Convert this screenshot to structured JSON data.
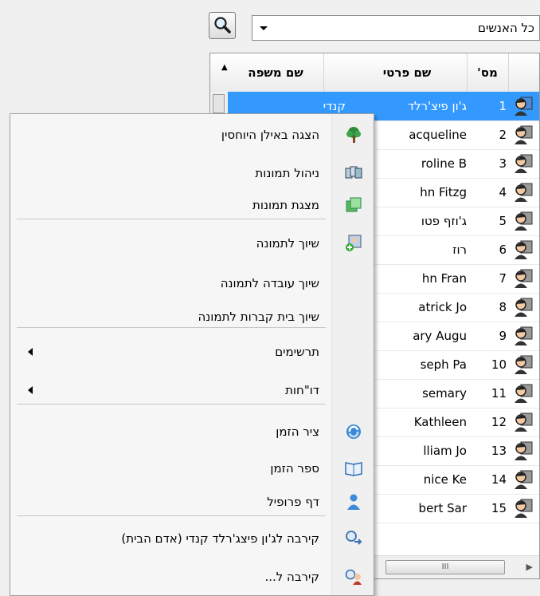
{
  "toolbar": {
    "search_icon": "magnifier-icon",
    "filter_value": "כל האנשים"
  },
  "grid": {
    "headers": {
      "last": "שם משפה",
      "first": "שם פרטי",
      "num": "מס'"
    },
    "rows": [
      {
        "num": "1",
        "first": "ג'ון פיצ'רלד",
        "last": "קנדי",
        "selected": true
      },
      {
        "num": "2",
        "first": "acqueline",
        "last": ""
      },
      {
        "num": "3",
        "first": "roline B",
        "last": ""
      },
      {
        "num": "4",
        "first": "hn Fitzg",
        "last": ""
      },
      {
        "num": "5",
        "first": "ג'וזף פטו",
        "last": ""
      },
      {
        "num": "6",
        "first": "רוז",
        "last": ""
      },
      {
        "num": "7",
        "first": "hn Fran",
        "last": ""
      },
      {
        "num": "8",
        "first": "atrick Jo",
        "last": ""
      },
      {
        "num": "9",
        "first": "ary Augu",
        "last": ""
      },
      {
        "num": "10",
        "first": "seph Pa",
        "last": ""
      },
      {
        "num": "11",
        "first": "semary",
        "last": ""
      },
      {
        "num": "12",
        "first": "Kathleen",
        "last": ""
      },
      {
        "num": "13",
        "first": "lliam Jo",
        "last": ""
      },
      {
        "num": "14",
        "first": "nice Ke",
        "last": ""
      },
      {
        "num": "15",
        "first": "bert Sar",
        "last": ""
      }
    ],
    "hscroll_grip": "III"
  },
  "menu": {
    "items": [
      {
        "label": "הצגה באילן היוחסין",
        "icon": "family-tree-icon"
      },
      {
        "label": "ניהול תמונות",
        "icon": "photo-manager-icon"
      },
      {
        "label": "מצגת תמונות",
        "icon": "slideshow-icon"
      },
      {
        "label": "שיוך לתמונה",
        "icon": "assign-photo-icon"
      },
      {
        "label": "שיוך עובדה לתמונה",
        "icon": ""
      },
      {
        "label": "שיוך בית קברות לתמונה",
        "icon": ""
      },
      {
        "label": "תרשימים",
        "icon": "",
        "submenu": true
      },
      {
        "label": "דו\"חות",
        "icon": "",
        "submenu": true
      },
      {
        "label": "ציר הזמן",
        "icon": "timeline-icon"
      },
      {
        "label": "ספר הזמן",
        "icon": "time-book-icon"
      },
      {
        "label": "דף פרופיל",
        "icon": "profile-icon"
      },
      {
        "label": "קירבה לג'ון פיצג'רלד קנדי (אדם הבית)",
        "icon": "relationship-icon"
      },
      {
        "label": "קירבה ל...",
        "icon": "relationship-to-icon"
      }
    ]
  },
  "colors": {
    "selection": "#3399ff",
    "menu_bg": "#f6f6f6"
  }
}
